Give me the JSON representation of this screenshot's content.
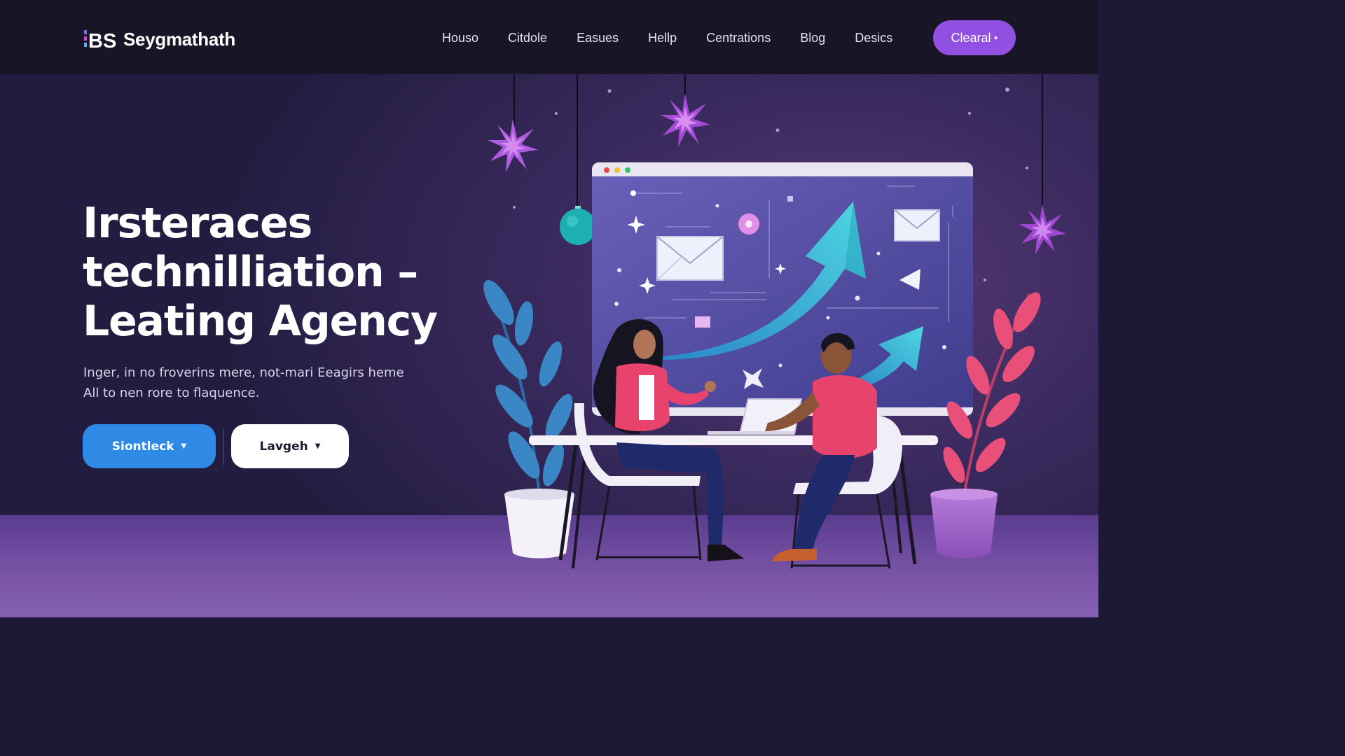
{
  "header": {
    "brand": "Seygmathath",
    "nav": [
      "Houso",
      "Citdole",
      "Easues",
      "Hellp",
      "Centrations",
      "Blog",
      "Desics"
    ],
    "cta_label": "Clearal",
    "cta_icon": "dot-icon"
  },
  "hero": {
    "headline": [
      "Irsteraces",
      "technilliation –",
      "Leating Agency"
    ],
    "subtext": [
      "Inger, in no froverins mere, not-mari Eeagirs heme",
      "All to nen rore to flaquence."
    ],
    "primary_button": "Siontleck",
    "secondary_button": "Lavgeh"
  },
  "colors": {
    "header_bg": "#181527",
    "accent_purple": "#9150e1",
    "primary_blue": "#2f8ae6",
    "arrow_teal": "#3cc4d6",
    "plant_pink": "#e8507a"
  },
  "icons": [
    "envelope-icon",
    "growth-arrow-icon",
    "sparkle-icon",
    "star-ornament-icon",
    "chevron-down-icon"
  ]
}
